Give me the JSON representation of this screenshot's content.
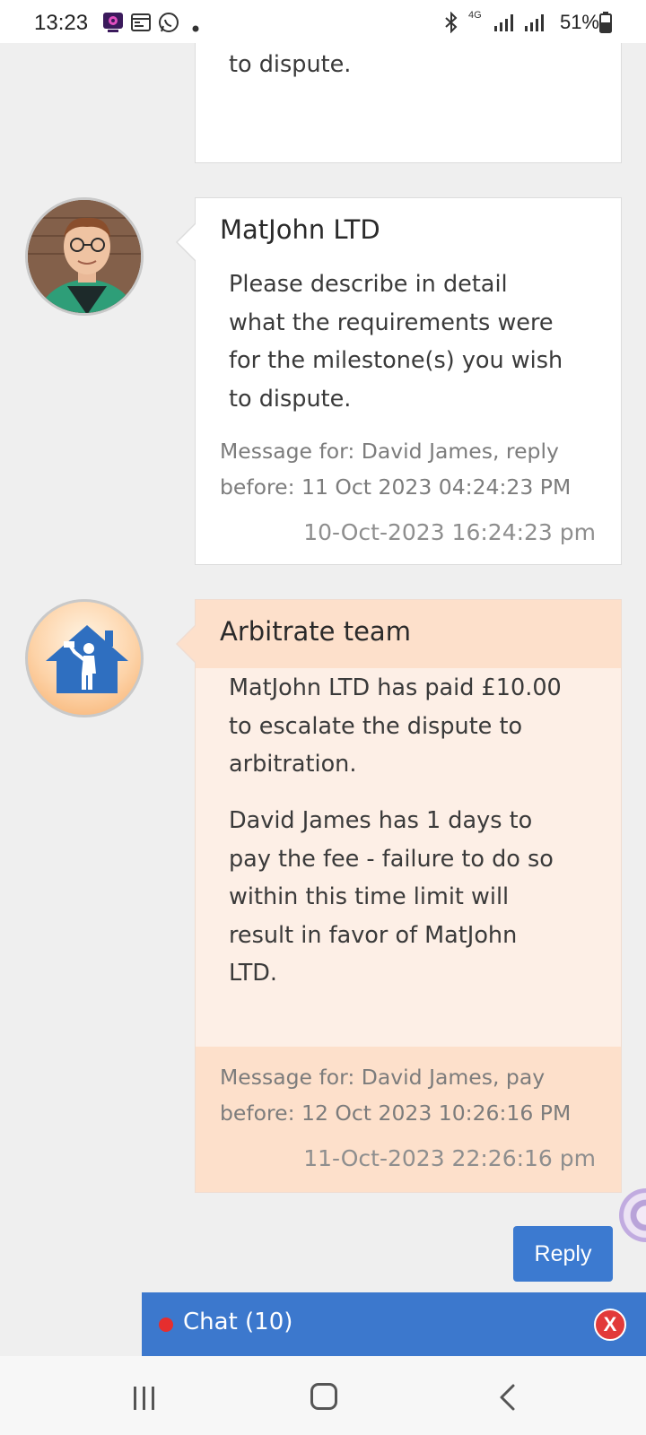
{
  "status_bar": {
    "time": "13:23",
    "network": "4G",
    "battery": "51%",
    "icons": [
      "app-notification-icon",
      "calendar-icon",
      "whatsapp-icon",
      "dot-icon",
      "bluetooth-icon",
      "signal-icon",
      "battery-icon"
    ]
  },
  "messages": [
    {
      "id": "previous",
      "body_lines": [
        "to dispute."
      ]
    },
    {
      "id": "matjohn",
      "sender": "MatJohn LTD",
      "body_lines": [
        "Please describe in detail",
        "what the requirements were",
        "for the milestone(s) you wish",
        "to dispute."
      ],
      "meta_lines": [
        "Message for: David James, reply",
        "before: 11 Oct 2023 04:24:23 PM"
      ],
      "date": "10-Oct-2023 16:24:23 pm"
    },
    {
      "id": "arbitrate",
      "sender": "Arbitrate team",
      "paragraph1_lines": [
        "MatJohn LTD has paid £10.00",
        "to escalate the dispute to",
        "arbitration."
      ],
      "paragraph2_lines": [
        "David James has 1 days to",
        "pay the fee - failure to do so",
        "within this time limit will",
        "result in favor of MatJohn",
        "LTD."
      ],
      "meta_lines": [
        "Message for: David James, pay",
        "before: 12 Oct 2023 10:26:16 PM"
      ],
      "date": "11-Oct-2023 22:26:16 pm"
    }
  ],
  "reply_button": {
    "label": "Reply"
  },
  "chat_bar": {
    "label": "Chat (10)",
    "close": "X"
  },
  "colors": {
    "accent_blue": "#3c7ad0",
    "arbitrate_header": "#fde0cb",
    "arbitrate_body": "#fdefe6",
    "close_red": "#e23a3a"
  }
}
